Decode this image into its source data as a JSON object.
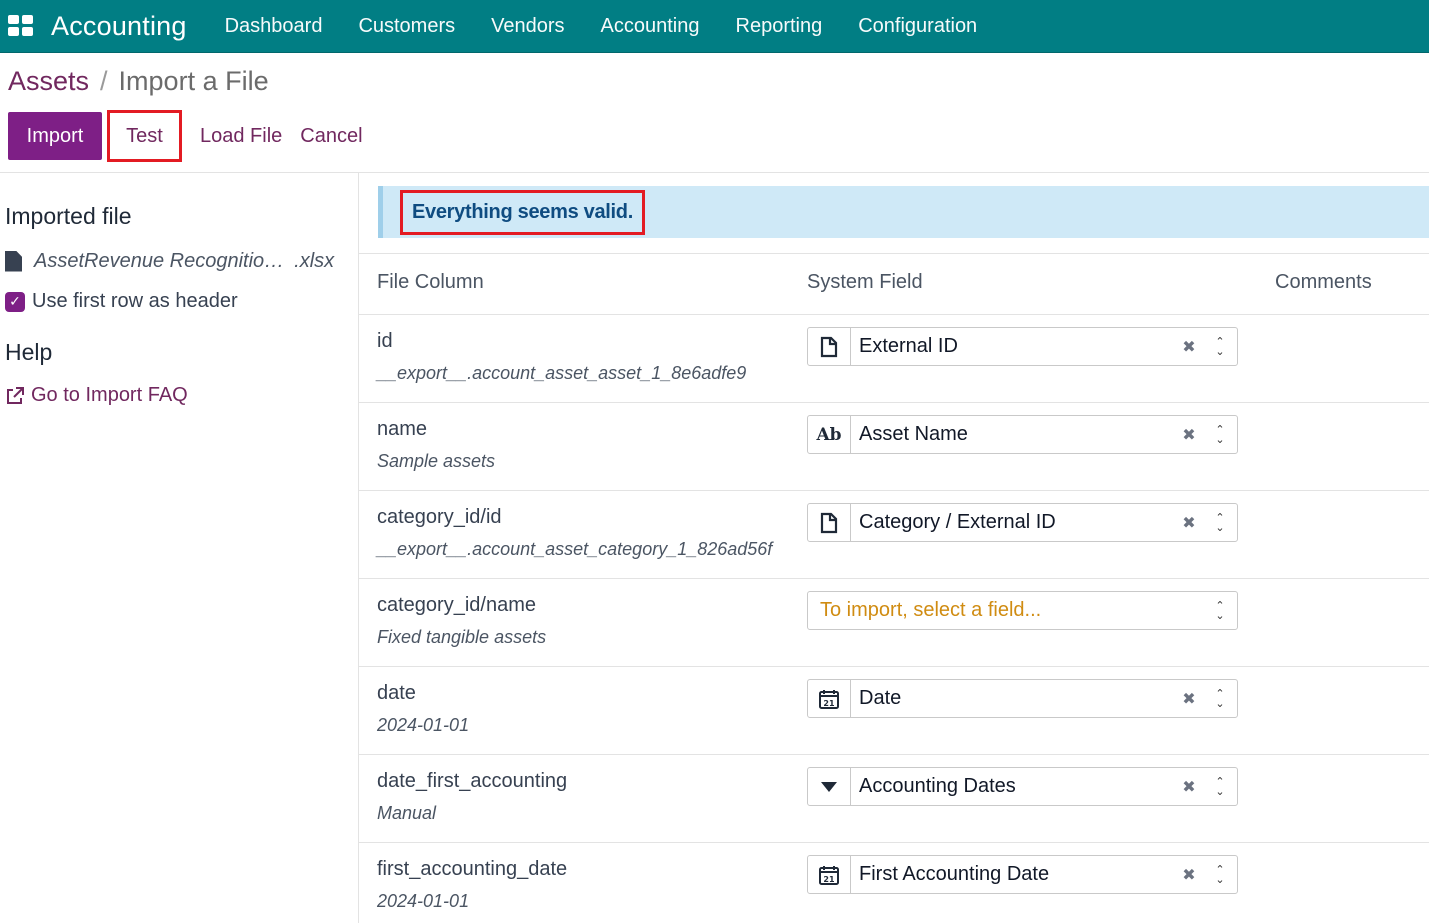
{
  "navbar": {
    "brand": "Accounting",
    "items": [
      "Dashboard",
      "Customers",
      "Vendors",
      "Accounting",
      "Reporting",
      "Configuration"
    ]
  },
  "breadcrumb": {
    "parent": "Assets",
    "separator": "/",
    "current": "Import a File"
  },
  "toolbar": {
    "import_label": "Import",
    "test_label": "Test",
    "load_file_label": "Load File",
    "cancel_label": "Cancel"
  },
  "sidebar": {
    "imported_file_title": "Imported file",
    "file_name": "AssetRevenue Recognitio…",
    "file_ext": ".xlsx",
    "use_header_label": "Use first row as header",
    "use_header_checked": true,
    "help_title": "Help",
    "faq_label": "Go to Import FAQ"
  },
  "alert": {
    "message": "Everything seems valid."
  },
  "table": {
    "headers": {
      "file_column": "File Column",
      "system_field": "System Field",
      "comments": "Comments"
    },
    "rows": [
      {
        "column": "id",
        "sample": "__export__.account_asset_asset_1_8e6adfe9",
        "field": "External ID",
        "icon": "document-icon"
      },
      {
        "column": "name",
        "sample": "Sample assets",
        "field": "Asset Name",
        "icon": "text-ab-icon"
      },
      {
        "column": "category_id/id",
        "sample": "__export__.account_asset_category_1_826ad56f",
        "field": "Category / External ID",
        "icon": "document-icon"
      },
      {
        "column": "category_id/name",
        "sample": "Fixed tangible assets",
        "field": "To import, select a field...",
        "icon": "",
        "placeholder": true
      },
      {
        "column": "date",
        "sample": "2024-01-01",
        "field": "Date",
        "icon": "calendar-icon"
      },
      {
        "column": "date_first_accounting",
        "sample": "Manual",
        "field": "Accounting Dates",
        "icon": "caret-down-icon"
      },
      {
        "column": "first_accounting_date",
        "sample": "2024-01-01",
        "field": "First Accounting Date",
        "icon": "calendar-icon"
      }
    ]
  },
  "colors": {
    "navbar": "#017e84",
    "primary": "#7e1f86",
    "link": "#71285f",
    "alert_bg": "#cfe9f7",
    "highlight": "#e31b23",
    "placeholder": "#d08c12"
  }
}
